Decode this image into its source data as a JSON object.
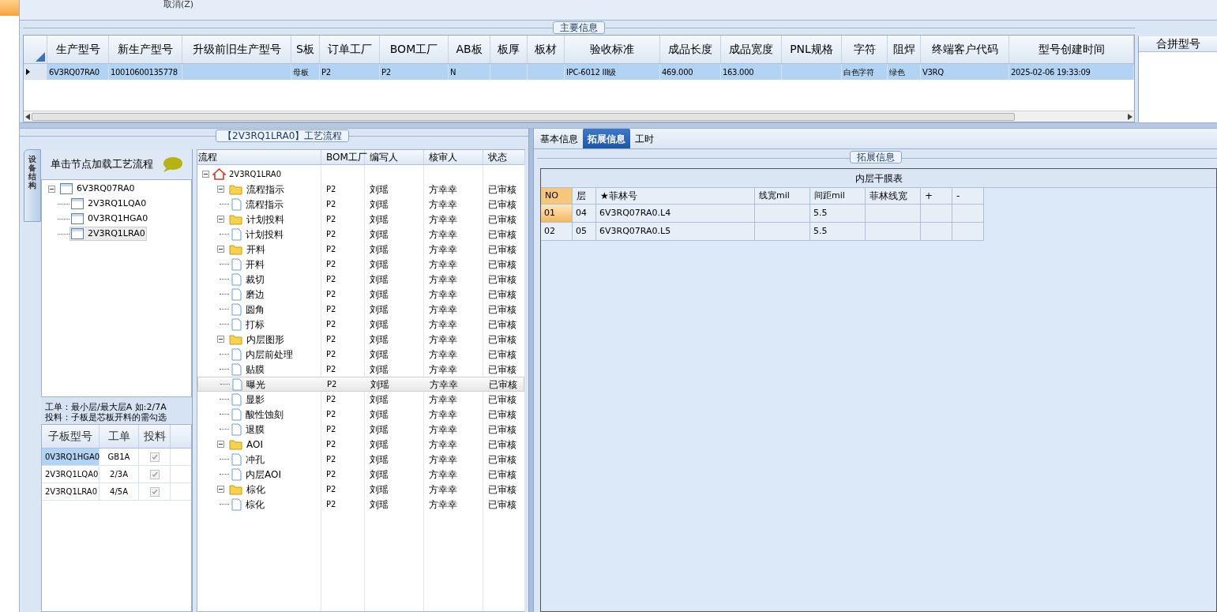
{
  "toolbar": {
    "cancel_label": "取消(Z)"
  },
  "main_info": {
    "title": "主要信息",
    "columns": [
      "生产型号",
      "新生产型号",
      "升级前旧生产型号",
      "S板",
      "订单工厂",
      "BOM工厂",
      "AB板",
      "板厚",
      "板材",
      "验收标准",
      "成品长度",
      "成品宽度",
      "PNL规格",
      "字符",
      "阻焊",
      "终端客户代码",
      "型号创建时间"
    ],
    "rows": [
      {
        "selected": true,
        "cells": [
          "6V3RQ07RA0",
          "10010600135778",
          "",
          "母板",
          "P2",
          "P2",
          "N",
          "",
          "",
          "IPC-6012 III级",
          "469.000",
          "163.000",
          "",
          "白色字符",
          "绿色",
          "V3RQ",
          "2025-02-06 19:33:09"
        ]
      }
    ],
    "merge_panel": {
      "title": "合拼型号"
    }
  },
  "process_panel": {
    "title": "【2V3RQ1LRA0】工艺流程",
    "side_tab": "设备结构",
    "tree_hint": "单击节点加载工艺流程",
    "board_tree": {
      "label": "6V3RQ07RA0",
      "expanded": true,
      "selected": false,
      "children": [
        {
          "label": "2V3RQ1LQA0",
          "selected": false
        },
        {
          "label": "0V3RQ1HGA0",
          "selected": false
        },
        {
          "label": "2V3RQ1LRA0",
          "selected": true
        }
      ]
    },
    "note_lines": [
      "工单：最小层/最大层A 如:2/7A",
      "投料：子板是芯板开料的需勾选"
    ],
    "sub_table": {
      "columns": [
        "子板型号",
        "工单",
        "投料"
      ],
      "rows": [
        {
          "model": "0V3RQ1HGA0",
          "order": "GB1A",
          "fed": true,
          "selected": true
        },
        {
          "model": "2V3RQ1LQA0",
          "order": "2/3A",
          "fed": true,
          "selected": false
        },
        {
          "model": "2V3RQ1LRA0",
          "order": "4/5A",
          "fed": true,
          "selected": false
        }
      ]
    }
  },
  "process_grid": {
    "columns": [
      "流程",
      "BOM工厂",
      "编写人",
      "核审人",
      "状态"
    ],
    "root": {
      "label": "2V3RQ1LRA0",
      "expanded": true
    },
    "steps": [
      {
        "label": "流程指示",
        "expanded": true,
        "bom": "P2",
        "writer": "刘瑶",
        "reviewer": "方幸幸",
        "status": "已审核",
        "children": [
          {
            "label": "流程指示",
            "bom": "P2",
            "writer": "刘瑶",
            "reviewer": "方幸幸",
            "status": "已审核",
            "selected": false
          }
        ]
      },
      {
        "label": "计划投料",
        "expanded": true,
        "bom": "P2",
        "writer": "刘瑶",
        "reviewer": "方幸幸",
        "status": "已审核",
        "children": [
          {
            "label": "计划投料",
            "bom": "P2",
            "writer": "刘瑶",
            "reviewer": "方幸幸",
            "status": "已审核",
            "selected": false
          }
        ]
      },
      {
        "label": "开料",
        "expanded": true,
        "bom": "P2",
        "writer": "刘瑶",
        "reviewer": "方幸幸",
        "status": "已审核",
        "children": [
          {
            "label": "开料",
            "bom": "P2",
            "writer": "刘瑶",
            "reviewer": "方幸幸",
            "status": "已审核",
            "selected": false
          },
          {
            "label": "裁切",
            "bom": "P2",
            "writer": "刘瑶",
            "reviewer": "方幸幸",
            "status": "已审核",
            "selected": false
          },
          {
            "label": "磨边",
            "bom": "P2",
            "writer": "刘瑶",
            "reviewer": "方幸幸",
            "status": "已审核",
            "selected": false
          },
          {
            "label": "圆角",
            "bom": "P2",
            "writer": "刘瑶",
            "reviewer": "方幸幸",
            "status": "已审核",
            "selected": false
          },
          {
            "label": "打标",
            "bom": "P2",
            "writer": "刘瑶",
            "reviewer": "方幸幸",
            "status": "已审核",
            "selected": false
          }
        ]
      },
      {
        "label": "内层图形",
        "expanded": true,
        "bom": "P2",
        "writer": "刘瑶",
        "reviewer": "方幸幸",
        "status": "已审核",
        "children": [
          {
            "label": "内层前处理",
            "bom": "P2",
            "writer": "刘瑶",
            "reviewer": "方幸幸",
            "status": "已审核",
            "selected": false
          },
          {
            "label": "贴膜",
            "bom": "P2",
            "writer": "刘瑶",
            "reviewer": "方幸幸",
            "status": "已审核",
            "selected": false
          },
          {
            "label": "曝光",
            "bom": "P2",
            "writer": "刘瑶",
            "reviewer": "方幸幸",
            "status": "已审核",
            "selected": true
          },
          {
            "label": "显影",
            "bom": "P2",
            "writer": "刘瑶",
            "reviewer": "方幸幸",
            "status": "已审核",
            "selected": false
          },
          {
            "label": "酸性蚀刻",
            "bom": "P2",
            "writer": "刘瑶",
            "reviewer": "方幸幸",
            "status": "已审核",
            "selected": false
          },
          {
            "label": "退膜",
            "bom": "P2",
            "writer": "刘瑶",
            "reviewer": "方幸幸",
            "status": "已审核",
            "selected": false
          }
        ]
      },
      {
        "label": "AOI",
        "expanded": true,
        "bom": "P2",
        "writer": "刘瑶",
        "reviewer": "方幸幸",
        "status": "已审核",
        "children": [
          {
            "label": "冲孔",
            "bom": "P2",
            "writer": "刘瑶",
            "reviewer": "方幸幸",
            "status": "已审核",
            "selected": false
          },
          {
            "label": "内层AOI",
            "bom": "P2",
            "writer": "刘瑶",
            "reviewer": "方幸幸",
            "status": "已审核",
            "selected": false
          }
        ]
      },
      {
        "label": "棕化",
        "expanded": true,
        "bom": "P2",
        "writer": "刘瑶",
        "reviewer": "方幸幸",
        "status": "已审核",
        "children": [
          {
            "label": "棕化",
            "bom": "P2",
            "writer": "刘瑶",
            "reviewer": "方幸幸",
            "status": "已审核",
            "selected": false
          }
        ]
      }
    ]
  },
  "detail_panel": {
    "tabs": [
      {
        "label": "基本信息",
        "selected": false
      },
      {
        "label": "拓展信息",
        "selected": true
      },
      {
        "label": "工时",
        "selected": false
      }
    ],
    "group_title": "拓展信息",
    "table": {
      "title": "内层干膜表",
      "columns": [
        "NO",
        "层",
        "★菲林号",
        "线宽mil",
        "间距mil",
        "菲林线宽",
        "+",
        "-"
      ],
      "rows": [
        {
          "selected": true,
          "cells": [
            "01",
            "04",
            "6V3RQ07RA0.L4",
            "",
            "5.5",
            "",
            "",
            ""
          ]
        },
        {
          "selected": false,
          "cells": [
            "02",
            "05",
            "6V3RQ07RA0.L5",
            "",
            "5.5",
            "",
            "",
            ""
          ]
        }
      ]
    }
  }
}
